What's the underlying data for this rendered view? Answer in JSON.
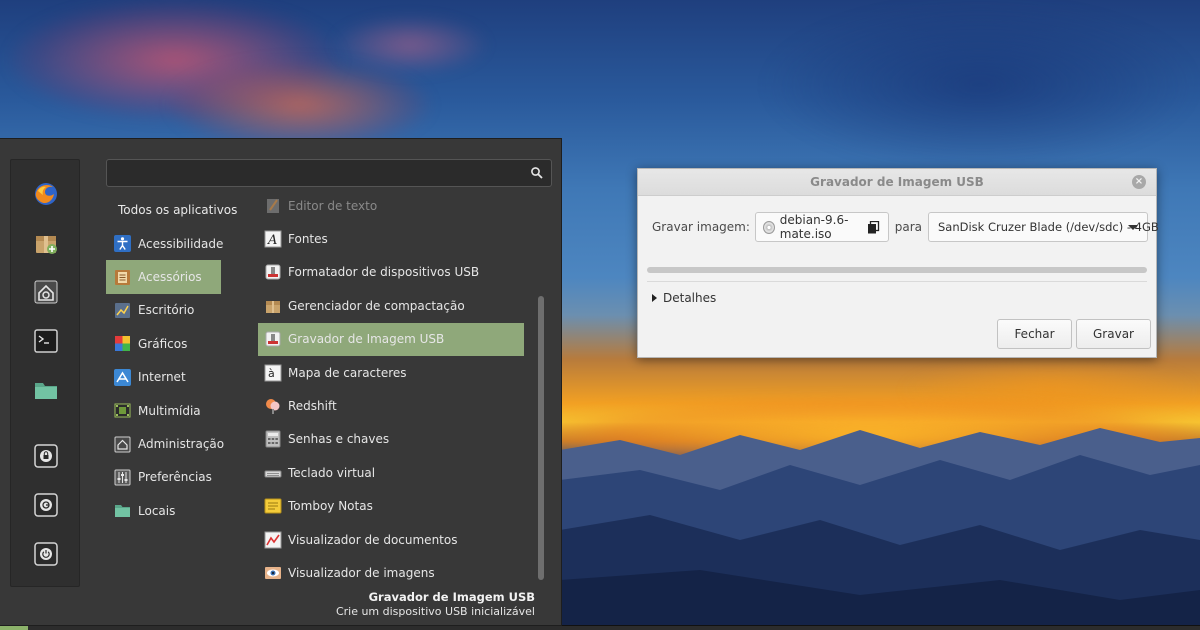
{
  "menu": {
    "search": {
      "value": "",
      "placeholder": ""
    },
    "favorites": [
      {
        "name": "firefox-icon"
      },
      {
        "name": "software-manager-icon"
      },
      {
        "name": "system-settings-icon"
      },
      {
        "name": "terminal-icon"
      },
      {
        "name": "folder-icon"
      },
      {
        "name": "lock-screen-icon"
      },
      {
        "name": "logout-icon"
      },
      {
        "name": "shutdown-icon"
      }
    ],
    "categories_header": "Todos os aplicativos",
    "categories": [
      {
        "label": "Acessibilidade",
        "icon": "accessibility-icon"
      },
      {
        "label": "Acessórios",
        "icon": "accessories-icon",
        "active": true
      },
      {
        "label": "Escritório",
        "icon": "office-icon"
      },
      {
        "label": "Gráficos",
        "icon": "graphics-icon"
      },
      {
        "label": "Internet",
        "icon": "internet-icon"
      },
      {
        "label": "Multimídia",
        "icon": "multimedia-icon"
      },
      {
        "label": "Administração",
        "icon": "administration-icon"
      },
      {
        "label": "Preferências",
        "icon": "preferences-icon"
      },
      {
        "label": "Locais",
        "icon": "places-folder-icon"
      }
    ],
    "apps": [
      {
        "label": "Editor de texto",
        "icon": "text-editor-icon"
      },
      {
        "label": "Fontes",
        "icon": "fonts-icon"
      },
      {
        "label": "Formatador de dispositivos USB",
        "icon": "usb-formatter-icon"
      },
      {
        "label": "Gerenciador de compactação",
        "icon": "archive-manager-icon"
      },
      {
        "label": "Gravador de Imagem USB",
        "icon": "usb-image-writer-icon",
        "active": true
      },
      {
        "label": "Mapa de caracteres",
        "icon": "character-map-icon"
      },
      {
        "label": "Redshift",
        "icon": "redshift-icon"
      },
      {
        "label": "Senhas e chaves",
        "icon": "passwords-keys-icon"
      },
      {
        "label": "Teclado virtual",
        "icon": "virtual-keyboard-icon"
      },
      {
        "label": "Tomboy Notas",
        "icon": "tomboy-notes-icon"
      },
      {
        "label": "Visualizador de documentos",
        "icon": "document-viewer-icon"
      },
      {
        "label": "Visualizador de imagens",
        "icon": "image-viewer-icon"
      }
    ],
    "description": {
      "title": "Gravador de Imagem USB",
      "text": "Crie um dispositivo USB inicializável"
    }
  },
  "dialog": {
    "title": "Gravador de Imagem USB",
    "write_image_label": "Gravar imagem:",
    "image_file": "debian-9.6-mate.iso",
    "to_label": "para",
    "device": "SanDisk Cruzer Blade (/dev/sdc) - 4GB",
    "progress_percent": 0,
    "details_label": "Detalhes",
    "close_label": "Fechar",
    "write_label": "Gravar"
  },
  "colors": {
    "accent": "#8fa87a",
    "menu_bg": "#383838",
    "dialog_bg": "#f2f2f2"
  }
}
